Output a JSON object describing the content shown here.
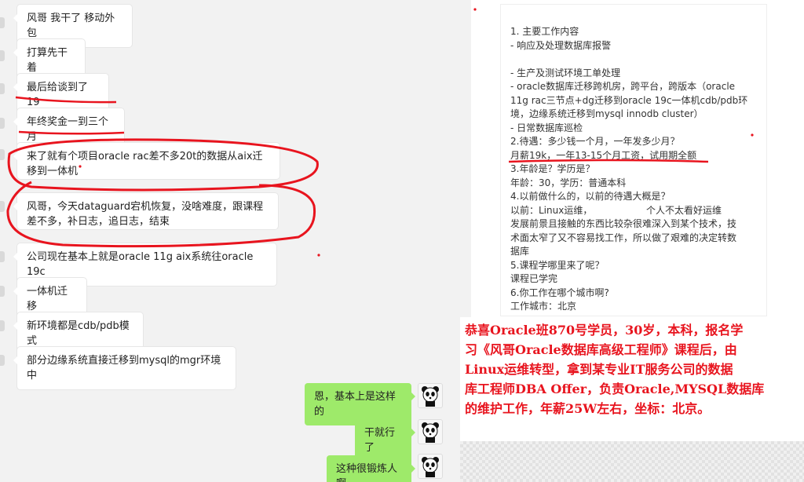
{
  "chat": {
    "messages_left": [
      "风哥 我干了 移动外包",
      "打算先干着",
      "最后给谈到了 19",
      "年终奖金一到三个月",
      "来了就有个项目oracle rac差不多20t的数据从aix迁移到一体机",
      "风哥，今天dataguard宕机恢复，没啥难度，跟课程差不多，补日志，追日志，结束",
      "公司现在基本上就是oracle 11g  aix系统往oracle 19c",
      "一体机迁移",
      "新环境都是cdb/pdb模式",
      "部分边缘系统直接迁移到mysql的mgr环境中"
    ],
    "messages_right": [
      "恩，基本上是这样的",
      "干就行了",
      "这种很锻炼人啊"
    ],
    "avatar_icon": "panda-avatar-icon"
  },
  "card": {
    "lines": [
      "1. 主要工作内容",
      "- 响应及处理数据库报警",
      "",
      "- 生产及测试环境工单处理",
      "- oracle数据库迁移跨机房，跨平台，跨版本（oracle",
      "11g rac三节点+dg迁移到oracle 19c一体机cdb/pdb环",
      "境，边缘系统迁移到mysql innodb cluster）",
      "- 日常数据库巡检",
      "2.待遇：多少钱一个月，一年发多少月？",
      "月薪19k，一年13-15个月工资，试用期全额",
      "3.年龄是？学历是？",
      "年龄：30，学历：普通本科",
      "4.以前做什么的，以前的待遇大概是？",
      "以前：Linux运维，                  个人不太看好运维",
      "发展前景且接触的东西比较杂很难深入到某个技术，技",
      "术面太窄了又不容易找工作，所以做了艰难的决定转数",
      "据库",
      "5.课程学哪里来了呢？",
      "课程已学完",
      "6.你工作在哪个城市啊?",
      "工作城市：北京"
    ]
  },
  "announcement": {
    "lines": [
      "恭喜Oracle班870号学员，30岁，本科，报名学",
      "习《风哥Oracle数据库高级工程师》课程后，由",
      "Linux运维转型，拿到某专业IT服务公司的数据",
      "库工程师DBA Offer，负责Oracle,MYSQL数据库",
      "的维护工作，年薪25W左右，坐标：北京。"
    ]
  },
  "colors": {
    "annotation_red": "#e8141e",
    "bubble_green": "#9eea6a"
  }
}
